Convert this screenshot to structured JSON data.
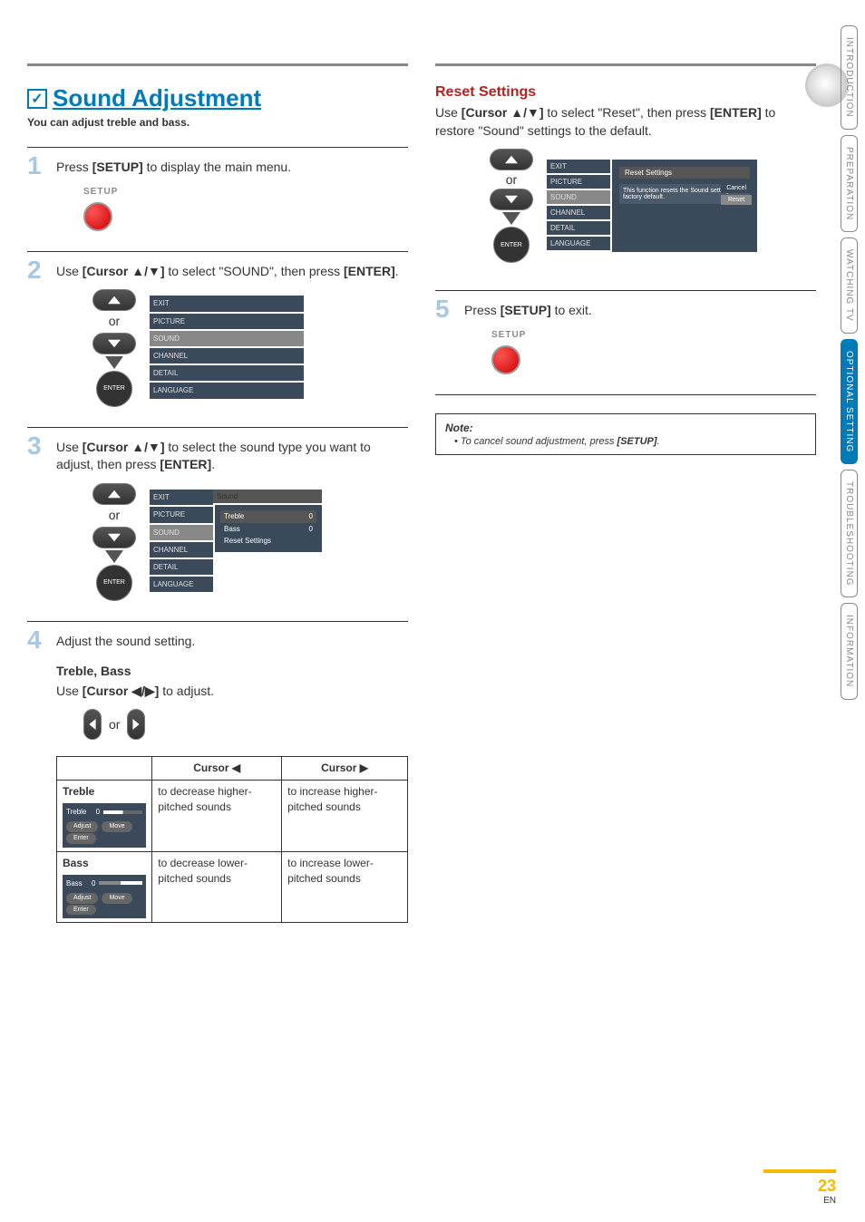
{
  "heading": "Sound Adjustment",
  "subheading": "You can adjust treble and bass.",
  "steps": {
    "s1": {
      "num": "1",
      "text_pre": "Press ",
      "key": "[SETUP]",
      "text_post": " to display the main menu.",
      "label": "SETUP"
    },
    "s2": {
      "num": "2",
      "text_pre": "Use ",
      "key": "[Cursor ▲/▼]",
      "text_mid": " to select \"SOUND\", then press",
      "key2": "[ENTER]",
      "text_post": "."
    },
    "s3": {
      "num": "3",
      "text_pre": "Use ",
      "key": "[Cursor ▲/▼]",
      "text_mid": " to select the sound type you want to adjust, then press ",
      "key2": "[ENTER]",
      "text_post": "."
    },
    "s4": {
      "num": "4",
      "text": "Adjust the sound setting."
    },
    "s5": {
      "num": "5",
      "text_pre": "Press ",
      "key": "[SETUP]",
      "text_post": " to exit.",
      "label": "SETUP"
    }
  },
  "or": "or",
  "enter_label": "ENTER",
  "menu": {
    "items": [
      "EXIT",
      "PICTURE",
      "SOUND",
      "CHANNEL",
      "DETAIL",
      "LANGUAGE"
    ],
    "sound_panel": {
      "header": "Sound",
      "rows": [
        [
          "Treble",
          "0"
        ],
        [
          "Bass",
          "0"
        ],
        [
          "Reset Settings",
          ""
        ]
      ]
    },
    "reset_panel": {
      "header": "Reset Settings",
      "text": "This function resets the Sound settings to factory default.",
      "btn_cancel": "Cancel",
      "btn_reset": "Reset"
    }
  },
  "sub_section": {
    "title": "Treble, Bass",
    "text_pre": "Use ",
    "key": "[Cursor ◀/▶]",
    "text_post": " to adjust."
  },
  "table": {
    "h_left": "Cursor ◀",
    "h_right": "Cursor ▶",
    "treble": {
      "label": "Treble",
      "panel": {
        "name": "Treble",
        "val": "0",
        "adjust": "Adjust",
        "move": "Move",
        "enter": "Enter"
      },
      "left": "to decrease higher-pitched sounds",
      "right": "to increase higher-pitched sounds"
    },
    "bass": {
      "label": "Bass",
      "panel": {
        "name": "Bass",
        "val": "0",
        "adjust": "Adjust",
        "move": "Move",
        "enter": "Enter"
      },
      "left": "to decrease lower-pitched sounds",
      "right": "to increase lower-pitched sounds"
    }
  },
  "reset": {
    "heading": "Reset Settings",
    "text_pre": "Use ",
    "key": "[Cursor ▲/▼]",
    "key_post_a": " to select \"Reset\", then press ",
    "key2": "[ENTER]",
    "text_post": " to restore \"Sound\" settings to the default."
  },
  "note": {
    "title": "Note:",
    "item_pre": "• To cancel sound adjustment, press ",
    "key": "[SETUP]",
    "post": "."
  },
  "tabs": [
    "INTRODUCTION",
    "PREPARATION",
    "WATCHING TV",
    "OPTIONAL SETTING",
    "TROUBLESHOOTING",
    "INFORMATION"
  ],
  "page": {
    "num": "23",
    "en": "EN"
  }
}
